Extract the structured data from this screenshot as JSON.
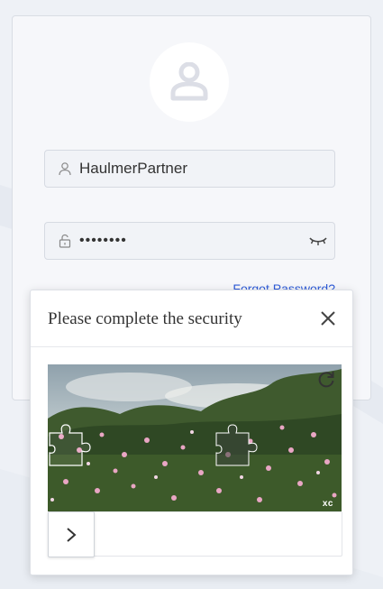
{
  "login": {
    "username_value": "HaulmerPartner",
    "password_value": "••••••••",
    "forgot_label": "Forgot Password?"
  },
  "captcha": {
    "title": "Please complete the security",
    "brand": "xc",
    "slider_progress": 0
  },
  "colors": {
    "link": "#2e5bd8",
    "background": "#eef1f6"
  }
}
